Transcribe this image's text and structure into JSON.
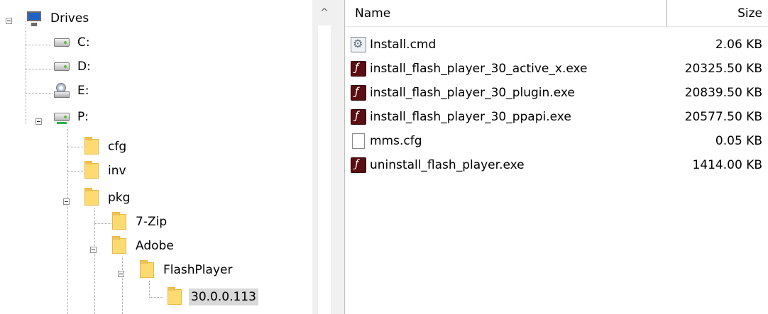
{
  "tree": {
    "root": {
      "label": "Drives",
      "icon": "computer-icon"
    },
    "drives": [
      {
        "label": "C:",
        "icon": "hard-drive-icon"
      },
      {
        "label": "D:",
        "icon": "hard-drive-icon"
      },
      {
        "label": "E:",
        "icon": "cd-drive-icon"
      },
      {
        "label": "P:",
        "icon": "network-drive-icon"
      }
    ],
    "folders": [
      {
        "label": "cfg"
      },
      {
        "label": "inv"
      },
      {
        "label": "pkg"
      },
      {
        "label": "7-Zip"
      },
      {
        "label": "Adobe"
      },
      {
        "label": "FlashPlayer"
      },
      {
        "label": "30.0.0.113",
        "selected": true
      }
    ]
  },
  "scrollbar": {
    "up_arrow": "^"
  },
  "list": {
    "columns": {
      "name": "Name",
      "size": "Size"
    },
    "files": [
      {
        "name": "Install.cmd",
        "size": "2.06 KB",
        "icon": "script-icon"
      },
      {
        "name": "install_flash_player_30_active_x.exe",
        "size": "20325.50 KB",
        "icon": "flash-icon"
      },
      {
        "name": "install_flash_player_30_plugin.exe",
        "size": "20839.50 KB",
        "icon": "flash-icon"
      },
      {
        "name": "install_flash_player_30_ppapi.exe",
        "size": "20577.50 KB",
        "icon": "flash-icon"
      },
      {
        "name": "mms.cfg",
        "size": "0.05 KB",
        "icon": "file-icon"
      },
      {
        "name": "uninstall_flash_player.exe",
        "size": "1414.00 KB",
        "icon": "flash-icon"
      }
    ]
  },
  "colors": {
    "folder": "#fddb72",
    "selection": "#d9d9d9",
    "flash": "#5a0d13"
  }
}
